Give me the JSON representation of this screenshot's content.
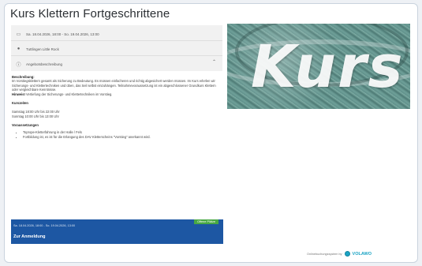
{
  "page": {
    "title": "Kurs Klettern Fortgeschrittene"
  },
  "info": {
    "date": "Sa. 18.04.2026, 18:00 - So. 19.04.2026, 13:00",
    "location": "Tuttlingen Little Rock",
    "description_toggle": "Angebotsbeschreibung"
  },
  "content": {
    "desc_heading": "Beschreibung:",
    "desc_text": "Im Vorstiegsklettern gesamt als Sicherung zu Bedeutung. Es müssen einfacheren und richtig abgesichert werden müssen. Im Kurs erlerlen wir Sicherungs- und Klettertechniken und üben, das Seil selbst einzuhängen. Teilnahmevoraussetzung ist ein abgeschlossener Grundkurs Klettern oder vergleichbare Kenntnisse.",
    "note_label": "Hinweis!",
    "note_text": "Vertiefung der Sicherungs- und Klettertechniken im Vorstieg.",
    "times_heading": "Kurszeiten",
    "time1": "Samstag 18:00 Uhr bis 22:00 Uhr",
    "time2": "Sonntag 10:00 Uhr bis 13:00 Uhr",
    "req_heading": "Voraussetzungen",
    "req1": "Toprope-Kletterfahrung in der Halle / Fels",
    "req2": "Fortbildung ist, es ist für die Erlangung des DAV Kletterscheins \"Vorstieg\" anerkannt wird."
  },
  "banner": {
    "badge": "Offene Plätze",
    "date": "Sa. 18.04.2026, 18:00 - So. 19.04.2026, 13:00",
    "link": "Zur Anmeldung"
  },
  "hero": {
    "word": "Kurs"
  },
  "footer": {
    "powered_by": "Onlinebuchungssystem by",
    "brand": "VOLAWO"
  }
}
